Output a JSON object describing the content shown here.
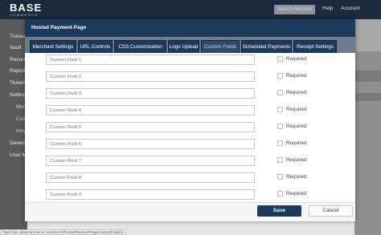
{
  "header": {
    "logo_main": "BASE",
    "logo_sub": "COMMERCE",
    "search_records": "Search Records",
    "help": "Help",
    "account": "Account"
  },
  "sidebar": {
    "items": [
      "Transa",
      "Vault",
      "Recurr",
      "Reporti",
      "Tickets",
      "Setting",
      "Merc",
      "Custo",
      "Hoste",
      "Develo",
      "User M"
    ]
  },
  "modal": {
    "title": "Hosted Payment Page",
    "tabs": [
      "Merchant Settings",
      "URL Controls",
      "CSS Customization",
      "Logo Upload",
      "Custom Fields",
      "Scheduled Payments",
      "Receipt Settings"
    ],
    "active_tab": "Custom Fields",
    "fields": [
      {
        "placeholder": "Custom Field 1",
        "required_label": "Required",
        "required": false
      },
      {
        "placeholder": "Custom Field 2",
        "required_label": "Required",
        "required": false
      },
      {
        "placeholder": "Custom Field 3",
        "required_label": "Required",
        "required": false
      },
      {
        "placeholder": "Custom Field 4",
        "required_label": "Required",
        "required": false
      },
      {
        "placeholder": "Custom Field 5",
        "required_label": "Required",
        "required": false
      },
      {
        "placeholder": "Custom Field 6",
        "required_label": "Required",
        "required": false
      },
      {
        "placeholder": "Custom Field 7",
        "required_label": "Required",
        "required": false
      },
      {
        "placeholder": "Custom Field 8",
        "required_label": "Required",
        "required": false
      },
      {
        "placeholder": "Custom Field 9",
        "required_label": "Required",
        "required": false
      }
    ],
    "save_label": "Save",
    "cancel_label": "Cancel"
  },
  "status_bar": {
    "url": "https://sec.basecommerce.com/merch/hostedPaymentPage/customFields/1"
  },
  "colors": {
    "navy": "#1c3a5c",
    "topbar": "#1c2a3e",
    "tab_strip": "#6e7b8b"
  }
}
